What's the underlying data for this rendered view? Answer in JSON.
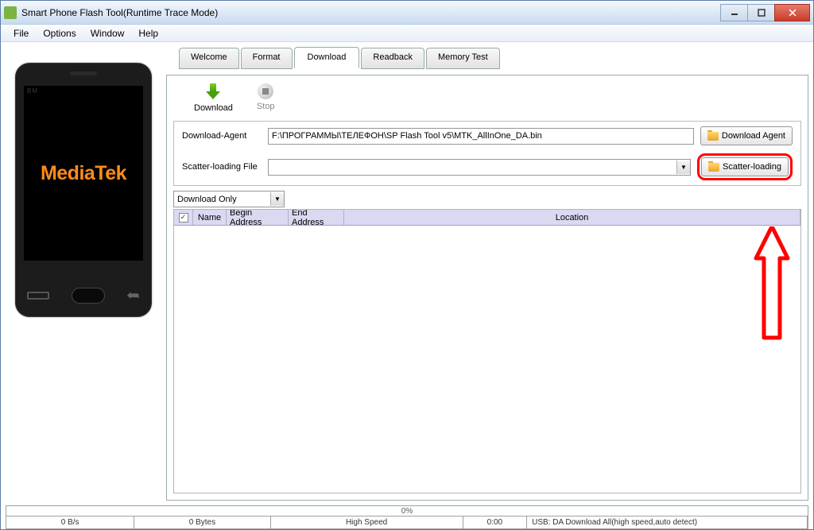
{
  "window": {
    "title": "Smart Phone Flash Tool(Runtime Trace Mode)"
  },
  "menu": {
    "file": "File",
    "options": "Options",
    "window": "Window",
    "help": "Help"
  },
  "phone": {
    "brand": "MediaTek",
    "bm": "BM"
  },
  "tabs": {
    "welcome": "Welcome",
    "format": "Format",
    "download": "Download",
    "readback": "Readback",
    "memory_test": "Memory Test"
  },
  "toolbar": {
    "download_label": "Download",
    "stop_label": "Stop"
  },
  "form": {
    "da_label": "Download-Agent",
    "da_value": "F:\\ПРОГРАММЫ\\ТЕЛЕФОН\\SP Flash Tool v5\\MTK_AllInOne_DA.bin",
    "da_btn": "Download Agent",
    "scatter_label": "Scatter-loading File",
    "scatter_value": "",
    "scatter_btn": "Scatter-loading",
    "mode_value": "Download Only"
  },
  "grid": {
    "col_name": "Name",
    "col_begin": "Begin Address",
    "col_end": "End Address",
    "col_location": "Location"
  },
  "status": {
    "progress_text": "0%",
    "speed": "0 B/s",
    "bytes": "0 Bytes",
    "mode": "High Speed",
    "time": "0:00",
    "usb": "USB: DA Download All(high speed,auto detect)"
  }
}
